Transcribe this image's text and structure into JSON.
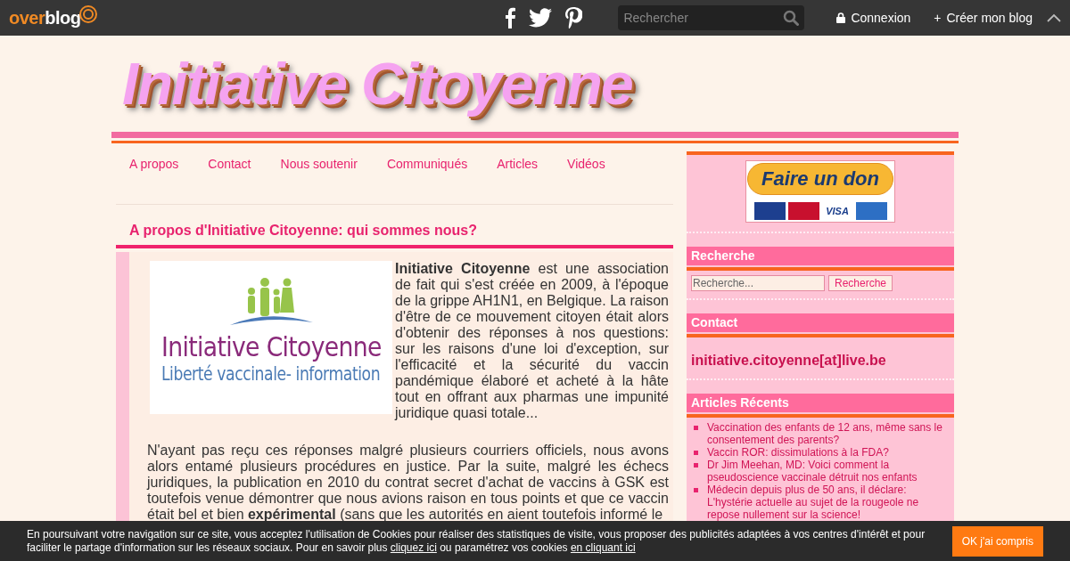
{
  "topbar": {
    "logo": {
      "part1": "over",
      "part2": "blog"
    },
    "search": {
      "placeholder": "Rechercher"
    },
    "login": "Connexion",
    "create": "Créer mon blog",
    "create_prefix": "+"
  },
  "header": {
    "title": "Initiative Citoyenne"
  },
  "nav": [
    {
      "label": "A propos"
    },
    {
      "label": "Contact"
    },
    {
      "label": "Nous soutenir"
    },
    {
      "label": "Communiqués"
    },
    {
      "label": "Articles"
    },
    {
      "label": "Vidéos"
    }
  ],
  "article": {
    "title": "A propos d'Initiative Citoyenne: qui sommes nous?",
    "image": {
      "title": "Initiative Citoyenne",
      "subtitle": "Liberté vaccinale- information"
    },
    "paragraphs": [
      "**Initiative Citoyenne** est une association de fait qui s'est créée en 2009, à l'époque de la grippe AH1N1, en Belgique. La raison d'être de ce mouvement citoyen était alors d'obtenir des réponses à nos questions: sur les raisons d'une loi d'exception, sur l'efficacité et la sécurité du vaccin pandémique élaboré et acheté à la hâte tout en offrant aux pharmas une impunité juridique quasi totale...",
      "N'ayant pas reçu ces réponses malgré plusieurs courriers officiels, nous avons alors entamé plusieurs procédures en justice. Par la suite, malgré les échecs juridiques, la publication en 2010 du contrat secret d'achat de vaccins à GSK est toutefois venue démontrer que nous avions raison en tous points et que ce vaccin était bel et bien **expérimental** (sans que les autorités en aient toutefois informé le"
    ]
  },
  "sidebar": {
    "donate": {
      "label": "Faire un don",
      "cards": [
        {
          "color": "#1d3f8f"
        },
        {
          "color": "#c8102e"
        },
        {
          "label": "VISA",
          "color": "#ffffff"
        },
        {
          "color": "#2d6fc4"
        }
      ]
    },
    "search": {
      "title": "Recherche",
      "placeholder": "Recherche...",
      "button": "Recherche"
    },
    "contact": {
      "title": "Contact",
      "email": "initiative.citoyenne[at]live.be"
    },
    "recent": {
      "title": "Articles Récents",
      "items": [
        "Vaccination des enfants de 12 ans, même sans le consentement des parents?",
        "Vaccin ROR: dissimulations à la FDA?",
        "Dr Jim Meehan, MD: Voici comment la pseudoscience vaccinale détruit nos enfants",
        "Médecin depuis plus de 50 ans, il déclare: L'hystérie actuelle au sujet de la rougeole ne repose nullement sur la science!"
      ]
    }
  },
  "cookie": {
    "parts": [
      "En poursuivant votre navigation sur ce site, vous acceptez l'utilisation de Cookies pour réaliser des statistiques de visite, vous proposer des publicités adaptées à vos centres d'intérêt et pour faciliter le partage d'information sur les réseaux sociaux. Pour en savoir plus ",
      "cliquez ici",
      " ou paramétrez vos cookies ",
      "en cliquant ici"
    ],
    "button": "OK j'ai compris"
  }
}
